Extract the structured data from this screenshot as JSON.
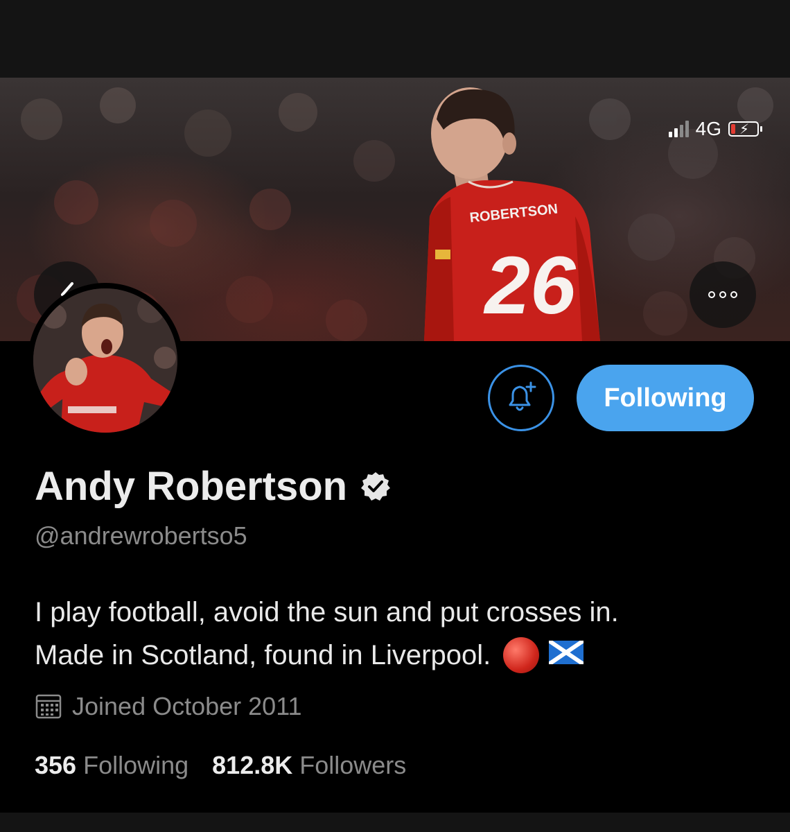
{
  "status_bar": {
    "network": "4G"
  },
  "banner": {
    "jersey_name": "ROBERTSON",
    "jersey_number": "26"
  },
  "profile": {
    "display_name": "Andy Robertson",
    "handle": "@andrewrobertso5",
    "bio_line_1": "I play football, avoid the sun and put crosses in.",
    "bio_line_2": "Made in Scotland, found in Liverpool.",
    "joined": "Joined October 2011",
    "verified": true
  },
  "actions": {
    "following_label": "Following"
  },
  "stats": {
    "following_count": "356",
    "following_label": "Following",
    "followers_count": "812.8K",
    "followers_label": "Followers"
  },
  "colors": {
    "accent": "#4aa4ee",
    "bell_border": "#3b92e6",
    "background": "#000000",
    "muted_text": "#8b8b8b",
    "jersey_red": "#c8201b"
  },
  "icons": [
    "back-chevron-icon",
    "more-dots-icon",
    "bell-plus-icon",
    "verified-badge-icon",
    "calendar-icon",
    "signal-icon",
    "battery-charging-icon",
    "red-circle-emoji",
    "scotland-flag-emoji"
  ]
}
